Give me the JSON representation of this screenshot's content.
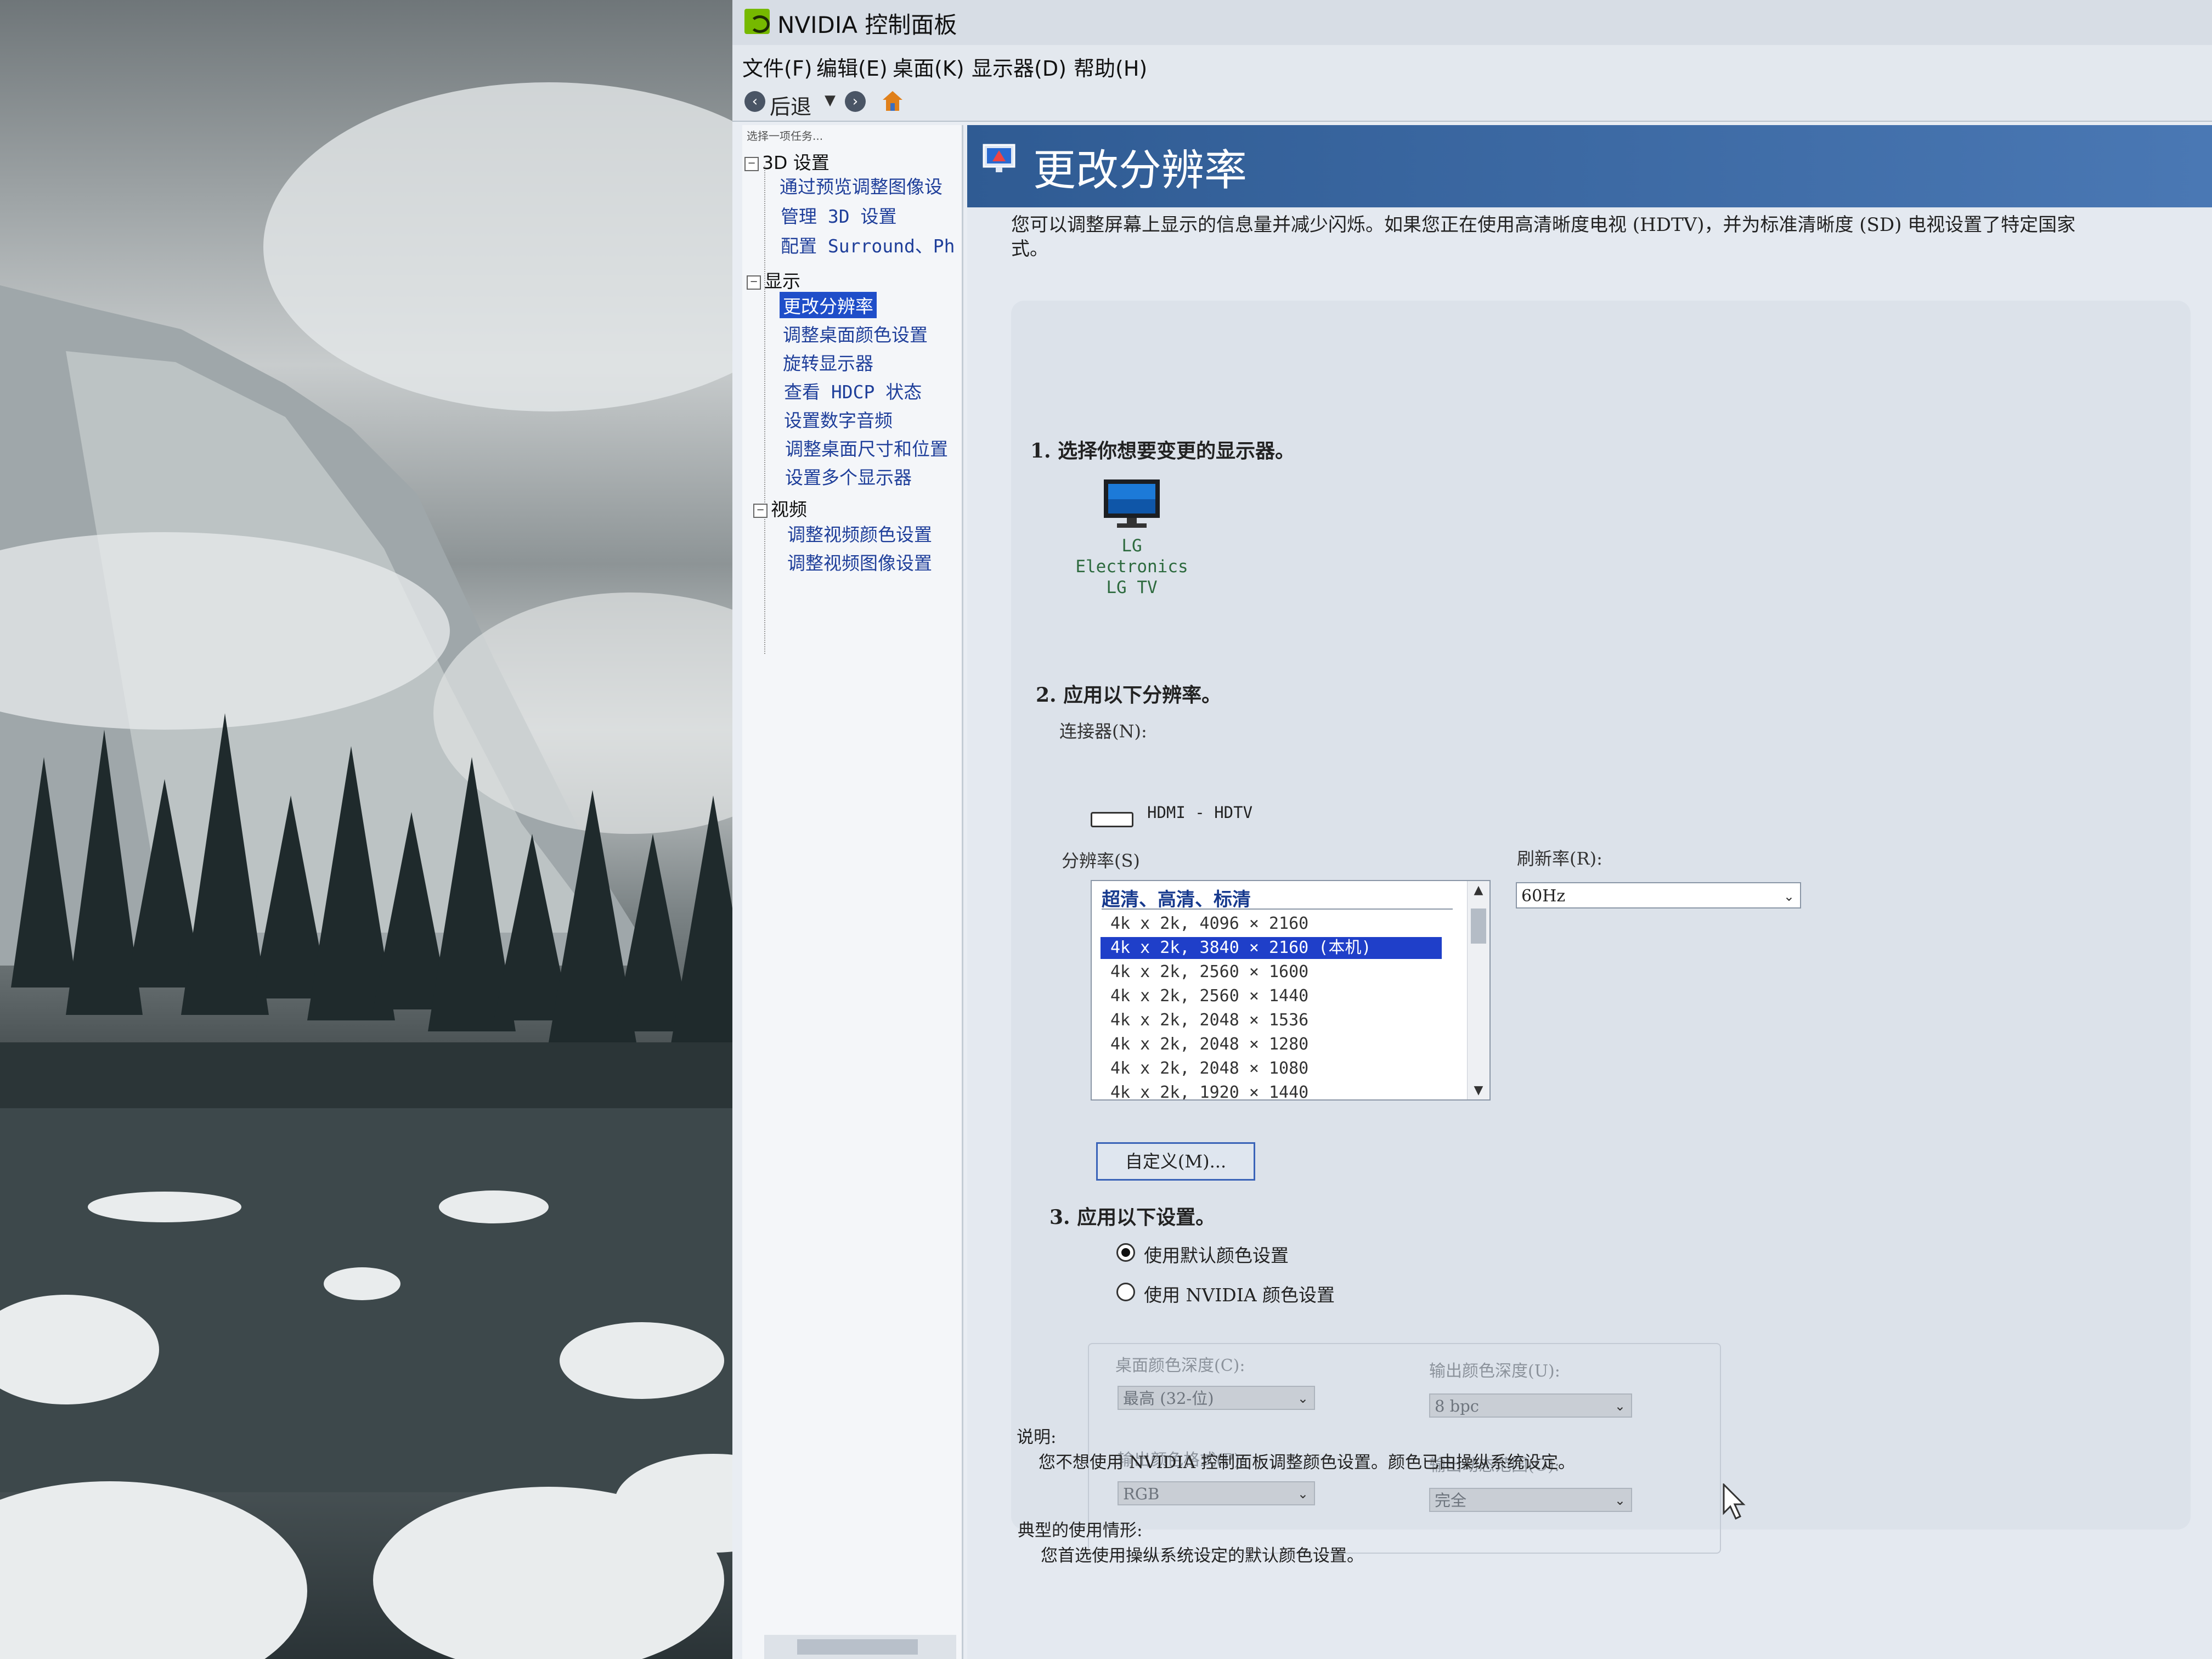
{
  "window": {
    "title": "NVIDIA 控制面板"
  },
  "menu": [
    "文件(F)",
    "编辑(E)",
    "桌面(K)",
    "显示器(D)",
    "帮助(H)"
  ],
  "toolbar": {
    "back_label": "后退"
  },
  "sidebar": {
    "task_label": "选择一项任务...",
    "categories": [
      {
        "label": "3D 设置",
        "expander": "−",
        "items": [
          "通过预览调整图像设",
          "管理 3D 设置",
          "配置 Surround、Ph"
        ]
      },
      {
        "label": "显示",
        "expander": "−",
        "items": [
          "更改分辨率",
          "调整桌面颜色设置",
          "旋转显示器",
          "查看 HDCP 状态",
          "设置数字音频",
          "调整桌面尺寸和位置",
          "设置多个显示器"
        ]
      },
      {
        "label": "视频",
        "expander": "−",
        "items": [
          "调整视频颜色设置",
          "调整视频图像设置"
        ]
      }
    ],
    "selected_item": "更改分辨率"
  },
  "page": {
    "title": "更改分辨率",
    "intro_line1": "您可以调整屏幕上显示的信息量并减少闪烁。如果您正在使用高清晰度电视 (HDTV)，并为标准清晰度 (SD) 电视设置了特定国家",
    "intro_line2": "式。"
  },
  "step1": {
    "title": "1. 选择你想要变更的显示器。",
    "display_name_line1": "LG Electronics",
    "display_name_line2": "LG TV"
  },
  "step2": {
    "title": "2. 应用以下分辨率。",
    "connector_label": "连接器(N):",
    "connector_value": "HDMI - HDTV",
    "resolution_label": "分辨率(S)",
    "resolution_group": "超清、高清、标清",
    "resolutions": [
      "4k x 2k, 4096 × 2160",
      "4k x 2k, 3840 × 2160 (本机)",
      "4k x 2k, 2560 × 1600",
      "4k x 2k, 2560 × 1440",
      "4k x 2k, 2048 × 1536",
      "4k x 2k, 2048 × 1280",
      "4k x 2k, 2048 × 1080",
      "4k x 2k, 1920 × 1440"
    ],
    "selected_resolution": "4k x 2k, 3840 × 2160 (本机)",
    "refresh_label": "刷新率(R):",
    "refresh_value": "60Hz",
    "custom_button": "自定义(M)..."
  },
  "step3": {
    "title": "3. 应用以下设置。",
    "radio_default": "使用默认颜色设置",
    "radio_nvidia": "使用 NVIDIA 颜色设置",
    "selected_radio": "default",
    "desktop_depth_label": "桌面颜色深度(C):",
    "desktop_depth_value": "最高 (32-位)",
    "output_depth_label": "输出颜色深度(U):",
    "output_depth_value": "8 bpc",
    "output_format_label": "输出颜色格式(P):",
    "output_format_value": "RGB",
    "dynamic_range_label": "输出动态范围(O):",
    "dynamic_range_value": "完全"
  },
  "notes": {
    "description_heading": "说明:",
    "description_text": "您不想使用 NVIDIA 控制面板调整颜色设置。颜色已由操纵系统设定。",
    "usage_heading": "典型的使用情形:",
    "usage_text": "您首选使用操纵系统设定的默认颜色设置。"
  },
  "colors": {
    "nvidia_green": "#76b900",
    "banner_blue": "#3a68a4",
    "selection_blue": "#1f3fc9"
  }
}
